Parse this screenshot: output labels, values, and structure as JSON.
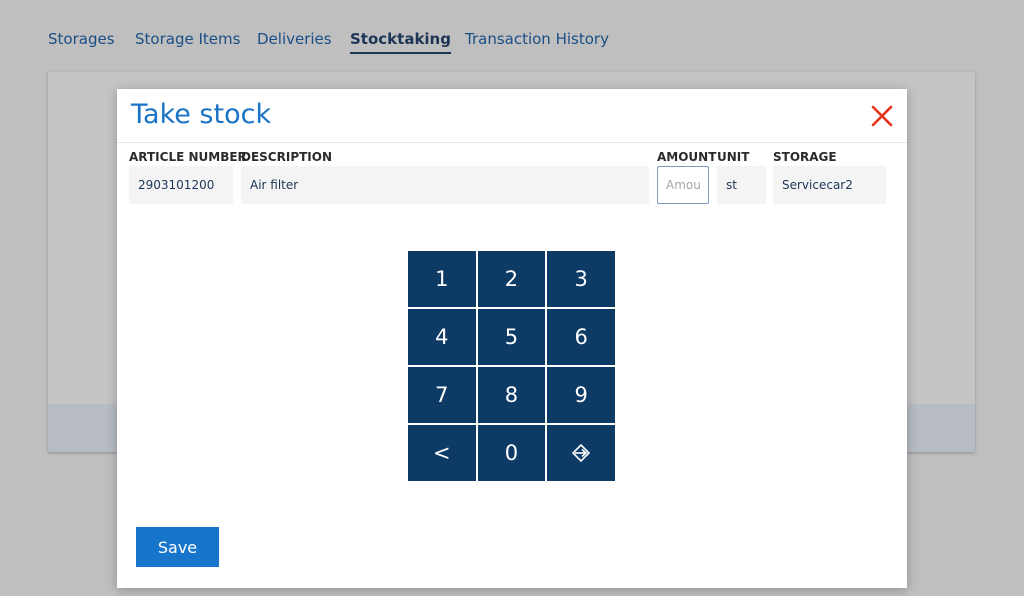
{
  "nav": {
    "tabs": [
      {
        "label": "Storages"
      },
      {
        "label": "Storage Items"
      },
      {
        "label": "Deliveries"
      },
      {
        "label": "Stocktaking"
      },
      {
        "label": "Transaction History"
      }
    ],
    "active_tab": "Stocktaking"
  },
  "modal": {
    "title": "Take stock",
    "close_icon": "close-icon",
    "close_color": "#e8341c",
    "columns": {
      "article_number": "ARTICLE NUMBER",
      "description": "DESCRIPTION",
      "amount": "AMOUNT",
      "unit": "UNIT",
      "storage": "STORAGE"
    },
    "row": {
      "article_number": "2903101200",
      "description": "Air filter",
      "amount_placeholder": "Amount",
      "unit": "st",
      "storage": "Servicecar2"
    },
    "keypad": {
      "keys": [
        "1",
        "2",
        "3",
        "4",
        "5",
        "6",
        "7",
        "8",
        "9",
        "<",
        "0",
        "⊕"
      ],
      "enter_icon": "enter-diamond-icon",
      "key_color": "#0e3a66"
    },
    "save_label": "Save",
    "accent_color": "#1776cc"
  }
}
